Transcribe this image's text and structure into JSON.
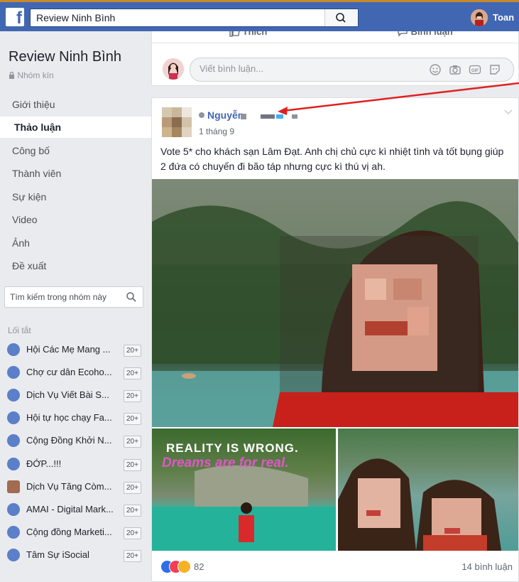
{
  "topbar": {
    "logo": "f",
    "search_value": "Review Ninh Bình",
    "user_name": "Toan"
  },
  "sidebar": {
    "group_name": "Review Ninh Bình",
    "group_type": "Nhóm kín",
    "nav": [
      {
        "label": "Giới thiệu",
        "active": false
      },
      {
        "label": "Thảo luận",
        "active": true
      },
      {
        "label": "Công bố",
        "active": false
      },
      {
        "label": "Thành viên",
        "active": false
      },
      {
        "label": "Sự kiện",
        "active": false
      },
      {
        "label": "Video",
        "active": false
      },
      {
        "label": "Ảnh",
        "active": false
      },
      {
        "label": "Đề xuất",
        "active": false
      }
    ],
    "search_placeholder": "Tìm kiếm trong nhóm này",
    "shortcuts_title": "Lối tắt",
    "shortcuts": [
      {
        "label": "Hội Các Mẹ Mang ...",
        "badge": "20+",
        "icon": "group-icon"
      },
      {
        "label": "Chợ cư dân Ecoho...",
        "badge": "20+",
        "icon": "group-icon"
      },
      {
        "label": "Dịch Vụ Viết Bài S...",
        "badge": "20+",
        "icon": "group-icon"
      },
      {
        "label": "Hội tự học chạy Fa...",
        "badge": "20+",
        "icon": "group-icon"
      },
      {
        "label": "Cộng Đồng Khởi N...",
        "badge": "20+",
        "icon": "group-icon"
      },
      {
        "label": "ĐỚP...!!!",
        "badge": "20+",
        "icon": "group-icon"
      },
      {
        "label": "Dịch Vụ Tăng Còm...",
        "badge": "20+",
        "icon": "photo-icon"
      },
      {
        "label": "AMAI - Digital Mark...",
        "badge": "20+",
        "icon": "group-icon"
      },
      {
        "label": "Cộng đồng Marketi...",
        "badge": "20+",
        "icon": "group-icon"
      },
      {
        "label": "Tâm Sự iSocial",
        "badge": "20+",
        "icon": "group-icon"
      }
    ]
  },
  "top_card": {
    "like_label": "Thích",
    "comment_label": "Bình luận",
    "comment_placeholder": "Viết bình luận..."
  },
  "post": {
    "author": "Nguyễn",
    "date": "1 tháng 9",
    "text": "Vote 5* cho khách sạn Lâm Đạt. Anh chị chủ cực kì nhiệt tình và tốt bụng giúp 2 đứa có chuyến đi bão táp nhưng cực kì thú vị ah.",
    "image_overlay_line1": "REALITY IS WRONG.",
    "image_overlay_line2": "Dreams are for real.",
    "reaction_count": "82",
    "comment_count": "14 bình luận"
  },
  "colors": {
    "brand": "#4267b2",
    "annotation_arrow": "#e02020"
  }
}
